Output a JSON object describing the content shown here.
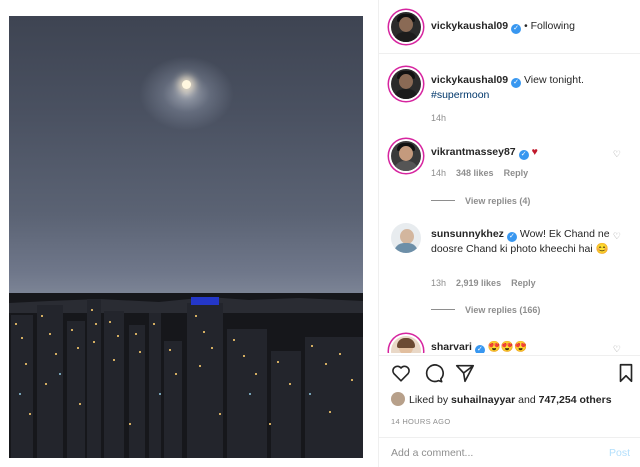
{
  "post": {
    "author": "vickykaushal09",
    "follow_status": "Following",
    "separator": "•"
  },
  "caption": {
    "username": "vickykaushal09",
    "text": "View tonight.",
    "hashtag": "#supermoon",
    "time": "14h"
  },
  "comments": [
    {
      "username": "vikrantmassey87",
      "text": "♥",
      "time": "14h",
      "likes": "348 likes",
      "reply": "Reply",
      "view_replies": "View replies (4)"
    },
    {
      "username": "sunsunnykhez",
      "text": "Wow! Ek Chand ne doosre Chand ki photo kheechi hai 😊",
      "time": "13h",
      "likes": "2,919 likes",
      "reply": "Reply",
      "view_replies": "View replies (166)"
    },
    {
      "username": "sharvari",
      "text": "😍😍😍"
    }
  ],
  "likes": {
    "prefix": "Liked by",
    "user": "suhailnayyar",
    "joiner": "and",
    "others": "747,254 others"
  },
  "posted_ago": "14 HOURS AGO",
  "add_comment": {
    "placeholder": "Add a comment...",
    "post_label": "Post"
  },
  "icons": {
    "like": "heart-outline-icon",
    "comment": "comment-bubble-icon",
    "share": "paper-plane-icon",
    "save": "bookmark-icon",
    "verified": "verified-badge-icon"
  },
  "colors": {
    "verified": "#3897f0",
    "hashtag": "#00376b",
    "muted": "#8e8e8e",
    "post_disabled": "#b2dffc",
    "heart_red": "#c0182b"
  }
}
